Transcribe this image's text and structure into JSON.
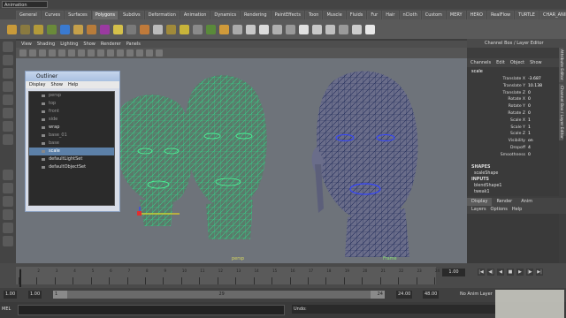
{
  "menu": {
    "mode": "Animation"
  },
  "shelf": {
    "tabs": [
      "General",
      "Curves",
      "Surfaces",
      "Polygons",
      "Subdivs",
      "Deformation",
      "Animation",
      "Dynamics",
      "Rendering",
      "PaintEffects",
      "Toon",
      "Muscle",
      "Fluids",
      "Fur",
      "Hair",
      "nCloth",
      "Custom",
      "MERY",
      "HERO",
      "RealFlow",
      "TURTLE",
      "CHAR_ANIM"
    ],
    "active_tab": "Polygons",
    "icon_colors": [
      "#c89a3a",
      "#8a7a40",
      "#b39a3a",
      "#6a8a3a",
      "#3a7ad0",
      "#c5a04a",
      "#b87c3a",
      "#9a3aa0",
      "#d4c04a",
      "#7a7a7a",
      "#c07a3a",
      "#bbbbbb",
      "#a08a3a",
      "#c8b43a",
      "#8a8a8a",
      "#5a8a3a",
      "#d09a3a",
      "#aaaaaa",
      "#c8c8c8",
      "#dddddd",
      "#b0b0b0",
      "#999999",
      "#e0e0e0",
      "#c8c8c8",
      "#bfbfbf",
      "#9a9a9a",
      "#cccccc",
      "#e8e8e8"
    ]
  },
  "viewport": {
    "menus": [
      "View",
      "Shading",
      "Lighting",
      "Show",
      "Renderer",
      "Panels"
    ],
    "labels": {
      "center": "persp",
      "right": "Frame"
    }
  },
  "outliner": {
    "title": "Outliner",
    "menus": [
      "Display",
      "Show",
      "Help"
    ],
    "items": [
      {
        "label": "persp",
        "state": "dim"
      },
      {
        "label": "top",
        "state": "dim"
      },
      {
        "label": "front",
        "state": "dim"
      },
      {
        "label": "side",
        "state": "dim"
      },
      {
        "label": "wrap",
        "state": "bright"
      },
      {
        "label": "base_01",
        "state": "dim"
      },
      {
        "label": "base",
        "state": "dim"
      },
      {
        "label": "scale",
        "state": "selected"
      },
      {
        "label": "defaultLightSet",
        "state": "bright"
      },
      {
        "label": "defaultObjectSet",
        "state": "bright"
      }
    ]
  },
  "channel_box": {
    "header": "Channel Box / Layer Editor",
    "menus": [
      "Channels",
      "Edit",
      "Object",
      "Show"
    ],
    "node": "scale",
    "attributes": [
      {
        "name": "Translate X",
        "value": "-3.687"
      },
      {
        "name": "Translate Y",
        "value": "10.138"
      },
      {
        "name": "Translate Z",
        "value": "0"
      },
      {
        "name": "Rotate X",
        "value": "0"
      },
      {
        "name": "Rotate Y",
        "value": "0"
      },
      {
        "name": "Rotate Z",
        "value": "0"
      },
      {
        "name": "Scale X",
        "value": "1"
      },
      {
        "name": "Scale Y",
        "value": "1"
      },
      {
        "name": "Scale Z",
        "value": "1"
      },
      {
        "name": "Visibility",
        "value": "on"
      },
      {
        "name": "Dropoff",
        "value": "4"
      },
      {
        "name": "Smoothness",
        "value": "0"
      }
    ],
    "shapes_header": "SHAPES",
    "shapes": [
      "scaleShape"
    ],
    "inputs_header": "INPUTS",
    "inputs": [
      "blendShape1",
      "tweak1"
    ]
  },
  "side_tabs": [
    "Attribute Editor",
    "Channel Box / Layer Editor"
  ],
  "layer_editor": {
    "tabs": [
      "Display",
      "Render",
      "Anim"
    ],
    "active_tab": "Display",
    "menus": [
      "Layers",
      "Options",
      "Help"
    ]
  },
  "timeline": {
    "ticks": [
      1,
      2,
      3,
      4,
      5,
      6,
      7,
      8,
      9,
      10,
      11,
      12,
      13,
      14,
      15,
      16,
      17,
      18,
      19,
      20,
      21,
      22,
      23,
      24
    ],
    "current_frame": "1.00",
    "playback_buttons": [
      "|◀",
      "◀|",
      "◀",
      "■",
      "▶",
      "|▶",
      "▶|"
    ]
  },
  "range": {
    "start": "1.00",
    "inner_start": "1.00",
    "slider_start": "1",
    "slider_mid": "29",
    "slider_end": "24",
    "end": "24.00",
    "outer_end": "48.00",
    "anim_layer": "No Anim Layer"
  },
  "command_line": {
    "mel_label": "MEL",
    "undo_label": "Undo:"
  }
}
